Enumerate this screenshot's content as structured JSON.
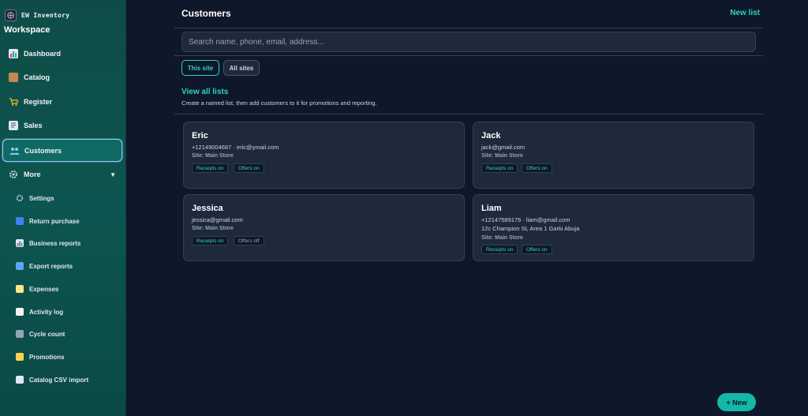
{
  "sidebar": {
    "brand": "EW Inventory",
    "workspace": "Workspace",
    "nav": [
      {
        "label": "Dashboard",
        "icon": "chart-icon"
      },
      {
        "label": "Catalog",
        "icon": "box-icon"
      },
      {
        "label": "Register",
        "icon": "cart-icon"
      },
      {
        "label": "Sales",
        "icon": "receipt-icon"
      },
      {
        "label": "Customers",
        "icon": "users-icon",
        "active": true
      },
      {
        "label": "More",
        "icon": "gear-icon"
      }
    ],
    "more_caret": "▼",
    "sub": [
      {
        "label": "Settings",
        "icon": "gear-icon"
      },
      {
        "label": "Return purchase",
        "icon": "return-icon"
      },
      {
        "label": "Business reports",
        "icon": "bar-chart-icon"
      },
      {
        "label": "Export reports",
        "icon": "export-icon"
      },
      {
        "label": "Expenses",
        "icon": "money-icon"
      },
      {
        "label": "Activity log",
        "icon": "clipboard-icon"
      },
      {
        "label": "Cycle count",
        "icon": "calculator-icon"
      },
      {
        "label": "Promotions",
        "icon": "ticket-icon"
      },
      {
        "label": "Catalog CSV import",
        "icon": "document-icon"
      }
    ]
  },
  "header": {
    "title": "Customers",
    "new_list": "New list"
  },
  "search": {
    "placeholder": "Search name, phone, email, address..."
  },
  "scope": {
    "this_site": "This site",
    "all_sites": "All sites"
  },
  "lists": {
    "view_all": "View all lists",
    "hint": "Create a named list, then add customers to it for promotions and reporting."
  },
  "customers": [
    {
      "name": "Eric",
      "contact": "+12149004687 · eric@ymail.com",
      "address": "",
      "site": "Site: Main Store",
      "receipts": "Receipts on",
      "offers": "Offers on"
    },
    {
      "name": "Jack",
      "contact": "jack@gmail.com",
      "address": "",
      "site": "Site: Main Store",
      "receipts": "Receipts on",
      "offers": "Offers on"
    },
    {
      "name": "Jessica",
      "contact": "jessica@gmail.com",
      "address": "",
      "site": "Site: Main Store",
      "receipts": "Receipts on",
      "offers": "Offers off"
    },
    {
      "name": "Liam",
      "contact": "+12147589176 · liam@gmail.com",
      "address": "12c Champion St, Area 1 Garki Abuja",
      "site": "Site: Main Store",
      "receipts": "Receipts on",
      "offers": "Offers on"
    }
  ],
  "fab": {
    "label": "+ New"
  },
  "colors": {
    "accent": "#2dd4bf",
    "sidebar": "#0f4c47",
    "background": "#0f172a",
    "card": "#1e293b"
  }
}
